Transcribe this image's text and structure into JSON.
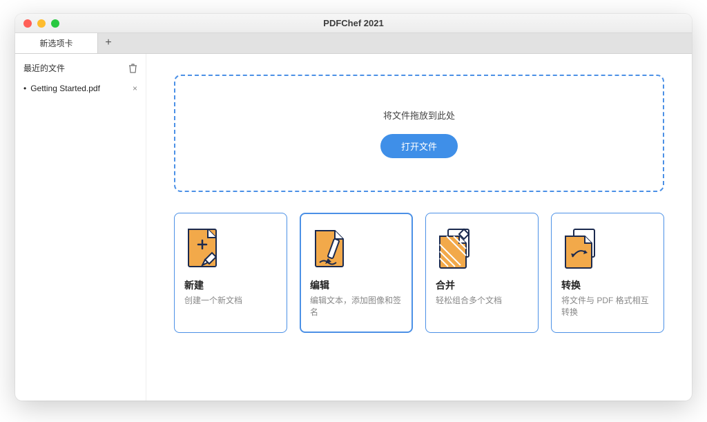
{
  "app_title": "PDFChef 2021",
  "tab": {
    "label": "新选项卡"
  },
  "sidebar": {
    "recent_label": "最近的文件",
    "items": [
      {
        "name": "Getting Started.pdf"
      }
    ]
  },
  "dropzone": {
    "hint": "将文件拖放到此处",
    "open_button": "打开文件"
  },
  "cards": [
    {
      "title": "新建",
      "subtitle": "创建一个新文档"
    },
    {
      "title": "编辑",
      "subtitle": "编辑文本，添加图像和签名"
    },
    {
      "title": "合并",
      "subtitle": "轻松组合多个文档"
    },
    {
      "title": "转换",
      "subtitle": "将文件与 PDF 格式相互转换"
    }
  ]
}
